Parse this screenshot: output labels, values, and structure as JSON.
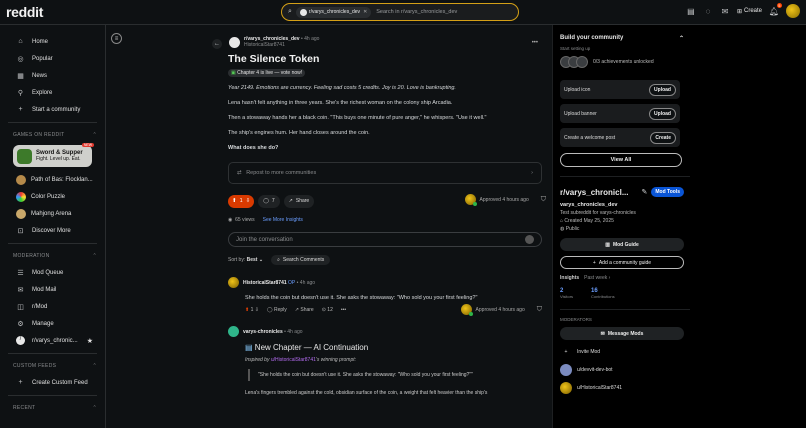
{
  "header": {
    "logo": "reddit",
    "search_chip": "r/varys_chronicles_dev",
    "search_chip_close": "✕",
    "search_placeholder": "Search in r/varys_chronicles_dev",
    "create_label": "Create",
    "notif_count": "5"
  },
  "sidebar": {
    "nav": [
      {
        "label": "Home",
        "icon": "home-icon"
      },
      {
        "label": "Popular",
        "icon": "popular-icon"
      },
      {
        "label": "News",
        "icon": "news-icon"
      },
      {
        "label": "Explore",
        "icon": "explore-icon"
      },
      {
        "label": "Start a community",
        "icon": "plus-icon"
      }
    ],
    "games_header": "GAMES ON REDDIT",
    "featured_game": {
      "title": "Sword & Supper",
      "subtitle": "Fight. Level up. Eat.",
      "badge": "NEW"
    },
    "games": [
      "Path of Bas: Flocklan...",
      "Color Puzzle",
      "Mahjong Arena",
      "Discover More"
    ],
    "moderation_header": "MODERATION",
    "moderation": [
      "Mod Queue",
      "Mod Mail",
      "r/Mod",
      "Manage",
      "r/varys_chronic..."
    ],
    "custom_feeds_header": "CUSTOM FEEDS",
    "custom_feed_item": "Create Custom Feed",
    "recent_header": "RECENT"
  },
  "post": {
    "subreddit": "r/varys_chronicles_dev",
    "time": "• 4h ago",
    "author": "HistoricalStar8741",
    "title": "The Silence Token",
    "flair": "Chapter 4 is live — vote now!",
    "paragraphs": [
      "Year 2149. Emotions are currency. Feeling sad costs 5 credits. Joy is 20. Love is bankrupting.",
      "Lena hasn't felt anything in three years. She's the richest woman on the colony ship Arcadia.",
      "Then a stowaway hands her a black coin. \"This buys one minute of pure anger,\" he whispers. \"Use it well.\"",
      "The ship's engines hum. Her hand closes around the coin.",
      "What does she do?"
    ],
    "repost_label": "Repost to more communities",
    "votes": "1",
    "comments": "7",
    "share": "Share",
    "approved": "Approved 4 hours ago",
    "views": "65 views",
    "insights_link": "See More Insights",
    "join_placeholder": "Join the conversation",
    "sort_label": "Sort by:",
    "sort_value": "Best",
    "search_comments": "Search Comments"
  },
  "comments": [
    {
      "author": "HistoricalStar8741",
      "op": "OP",
      "time": "• 4h ago",
      "text": "She holds the coin but doesn't use it. She asks the stowaway: \"Who sold you your first feeling?\"",
      "votes": "1",
      "reply": "Reply",
      "share": "Share",
      "awards": "12",
      "approved": "Approved 4 hours ago"
    },
    {
      "author": "varys-chronicles",
      "time": "• 4h ago",
      "chapter_title": "New Chapter — AI Continuation",
      "inspired_prefix": "Inspired by",
      "inspired_user": "u/HistoricalStar8741",
      "inspired_suffix": "'s winning prompt:",
      "quote": "\"She holds the coin but doesn't use it. She asks the stowaway: \"Who sold you your first feeling?\"\"",
      "continuation": "Lena's fingers trembled against the cold, obsidian surface of the coin, a weight that felt heavier than the ship's"
    }
  ],
  "right": {
    "build_title": "Build your community",
    "setting_up": "Start setting up",
    "achievements": "0/3 achievements unlocked",
    "tasks": [
      {
        "label": "Upload icon",
        "button": "Upload"
      },
      {
        "label": "Upload banner",
        "button": "Upload"
      },
      {
        "label": "Create a welcome post",
        "button": "Create"
      }
    ],
    "view_all": "View All",
    "sub_name": "r/varys_chronicl...",
    "mod_tools": "Mod Tools",
    "sub_title": "varys_chronicles_dev",
    "sub_desc": "Test subreddit for varys-chronicles",
    "created": "Created May 25, 2025",
    "visibility": "Public",
    "mod_guide": "Mod Guide",
    "add_guide": "Add a community guide",
    "insights_label": "Insights",
    "insights_range": "Past week",
    "visitors": "2",
    "visitors_label": "Visitors",
    "contributions": "16",
    "contributions_label": "Contributions",
    "moderators_header": "MODERATORS",
    "message_mods": "Message Mods",
    "invite_mod": "Invite Mod",
    "mods": [
      "u/devvit-dev-bot",
      "u/HistoricalStar8741"
    ]
  }
}
